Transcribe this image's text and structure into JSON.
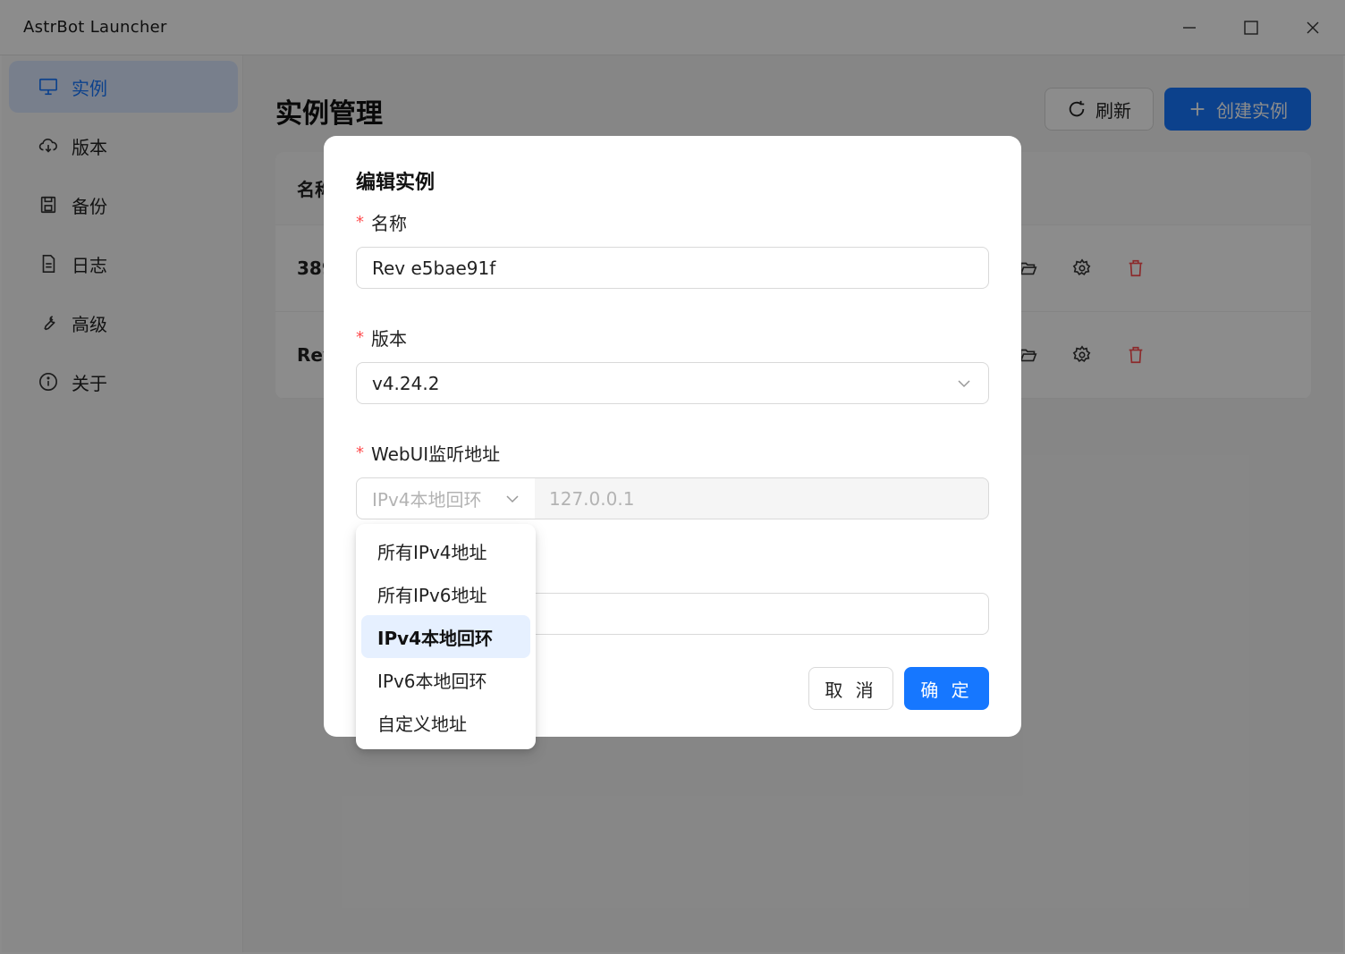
{
  "window": {
    "title": "AstrBot Launcher"
  },
  "sidebar": {
    "items": [
      {
        "label": "实例",
        "icon": "monitor-icon"
      },
      {
        "label": "版本",
        "icon": "cloud-download-icon"
      },
      {
        "label": "备份",
        "icon": "save-icon"
      },
      {
        "label": "日志",
        "icon": "file-text-icon"
      },
      {
        "label": "高级",
        "icon": "wrench-icon"
      },
      {
        "label": "关于",
        "icon": "info-icon"
      }
    ]
  },
  "main": {
    "title": "实例管理",
    "refresh_label": "刷新",
    "create_label": "创建实例",
    "table": {
      "header_name": "名称",
      "rows": [
        {
          "name": "389"
        },
        {
          "name": "Rev"
        }
      ]
    }
  },
  "modal": {
    "title": "编辑实例",
    "name_label": "名称",
    "name_value": "Rev e5bae91f",
    "version_label": "版本",
    "version_value": "v4.24.2",
    "webui_label": "WebUI监听地址",
    "address_type_value": "IPv4本地回环",
    "address_value": "127.0.0.1",
    "cancel_label": "取 消",
    "ok_label": "确 定"
  },
  "dropdown": {
    "options": [
      "所有IPv4地址",
      "所有IPv6地址",
      "IPv4本地回环",
      "IPv6本地回环",
      "自定义地址"
    ],
    "selected": "IPv4本地回环"
  },
  "colors": {
    "primary": "#1677ff",
    "danger": "#ff4d4f"
  }
}
